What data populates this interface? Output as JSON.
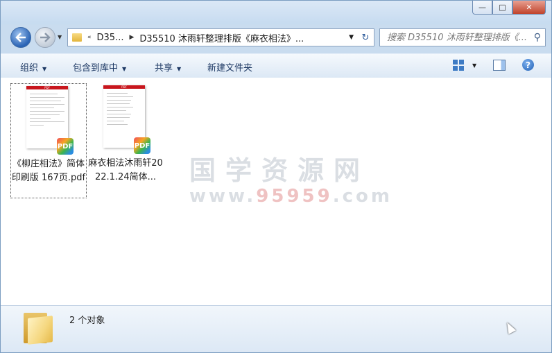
{
  "window": {
    "controls": {
      "minimize": "—",
      "maximize": "□",
      "close": "✕"
    }
  },
  "nav": {
    "address_crumbs": [
      "«",
      "D35...",
      "D35510 沐雨轩整理排版《麻衣相法》..."
    ],
    "search_placeholder": "搜索 D35510 沐雨轩整理排版《..."
  },
  "toolbar": {
    "organize": "组织",
    "include_in_library": "包含到库中",
    "share": "共享",
    "new_folder": "新建文件夹"
  },
  "files": [
    {
      "name": "《柳庄相法》简体印刷版 167页.pdf",
      "type": "PDF",
      "selected": true
    },
    {
      "name": "麻衣相法沐雨轩2022.1.24简体...",
      "type": "PDF",
      "selected": false
    }
  ],
  "watermark": {
    "line1": "国学资源网",
    "line2_a": "www.",
    "line2_b": "95959",
    "line2_c": ".com"
  },
  "status": {
    "object_count": "2 个对象"
  },
  "colors": {
    "chrome": "#c9dcef",
    "toolbar_text": "#1e3964",
    "pdf_red": "#c8161d"
  }
}
